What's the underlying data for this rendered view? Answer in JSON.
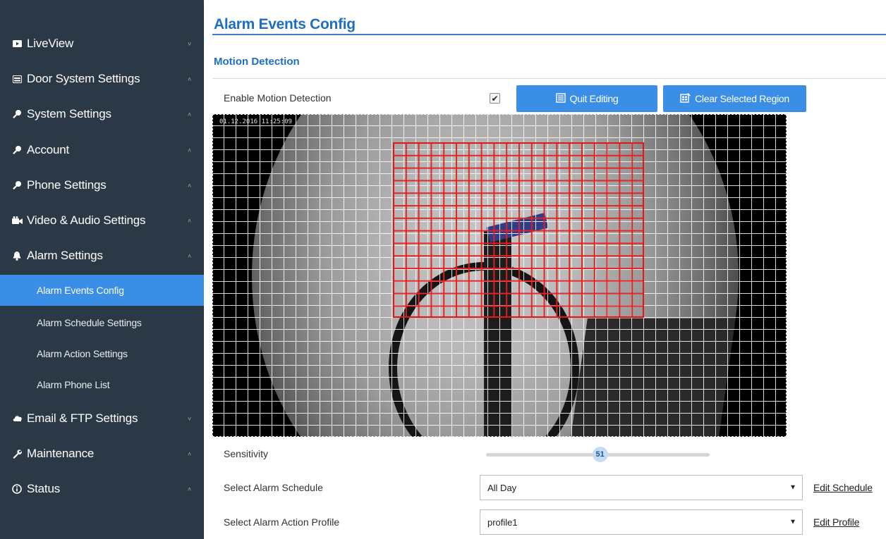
{
  "colors": {
    "sidebar_bg": "#2b3845",
    "active_item": "#3a8ee6",
    "title_blue": "#1e6fc0",
    "button_blue": "#3a8ee6",
    "region_red": "#e01818"
  },
  "sidebar": {
    "items": [
      {
        "label": "LiveView",
        "icon": "play-icon",
        "chevron": "˅"
      },
      {
        "label": "Door System Settings",
        "icon": "door-panel-icon",
        "chevron": "˄"
      },
      {
        "label": "System Settings",
        "icon": "gear-key-icon",
        "chevron": "˄"
      },
      {
        "label": "Account",
        "icon": "key-icon",
        "chevron": "˄"
      },
      {
        "label": "Phone Settings",
        "icon": "key-icon",
        "chevron": "˄"
      },
      {
        "label": "Video & Audio Settings",
        "icon": "video-icon",
        "chevron": "˄"
      },
      {
        "label": "Alarm Settings",
        "icon": "bell-icon",
        "chevron": "˄"
      },
      {
        "label": "Email & FTP Settings",
        "icon": "cloud-icon",
        "chevron": "˅"
      },
      {
        "label": "Maintenance",
        "icon": "wrench-icon",
        "chevron": "˄"
      },
      {
        "label": "Status",
        "icon": "info-icon",
        "chevron": "˄"
      }
    ],
    "alarm_subitems": [
      {
        "label": "Alarm Events Config",
        "active": true
      },
      {
        "label": "Alarm Schedule Settings",
        "active": false
      },
      {
        "label": "Alarm Action Settings",
        "active": false
      },
      {
        "label": "Alarm Phone List",
        "active": false
      }
    ]
  },
  "main": {
    "page_title": "Alarm Events Config",
    "section_title": "Motion Detection",
    "enable_label": "Enable Motion Detection",
    "enable_checked": true,
    "quit_editing_label": "Quit Editing",
    "clear_region_label": "Clear Selected Region",
    "timestamp": "01.12.2016 11:25:09",
    "sensitivity_label": "Sensitivity",
    "sensitivity_value": "51",
    "sensitivity_fraction": 0.51,
    "schedule_label": "Select Alarm Schedule",
    "schedule_value": "All Day",
    "edit_schedule_label": "Edit Schedule",
    "action_profile_label": "Select Alarm Action Profile",
    "action_profile_value": "profile1",
    "edit_profile_label": "Edit Profile"
  }
}
